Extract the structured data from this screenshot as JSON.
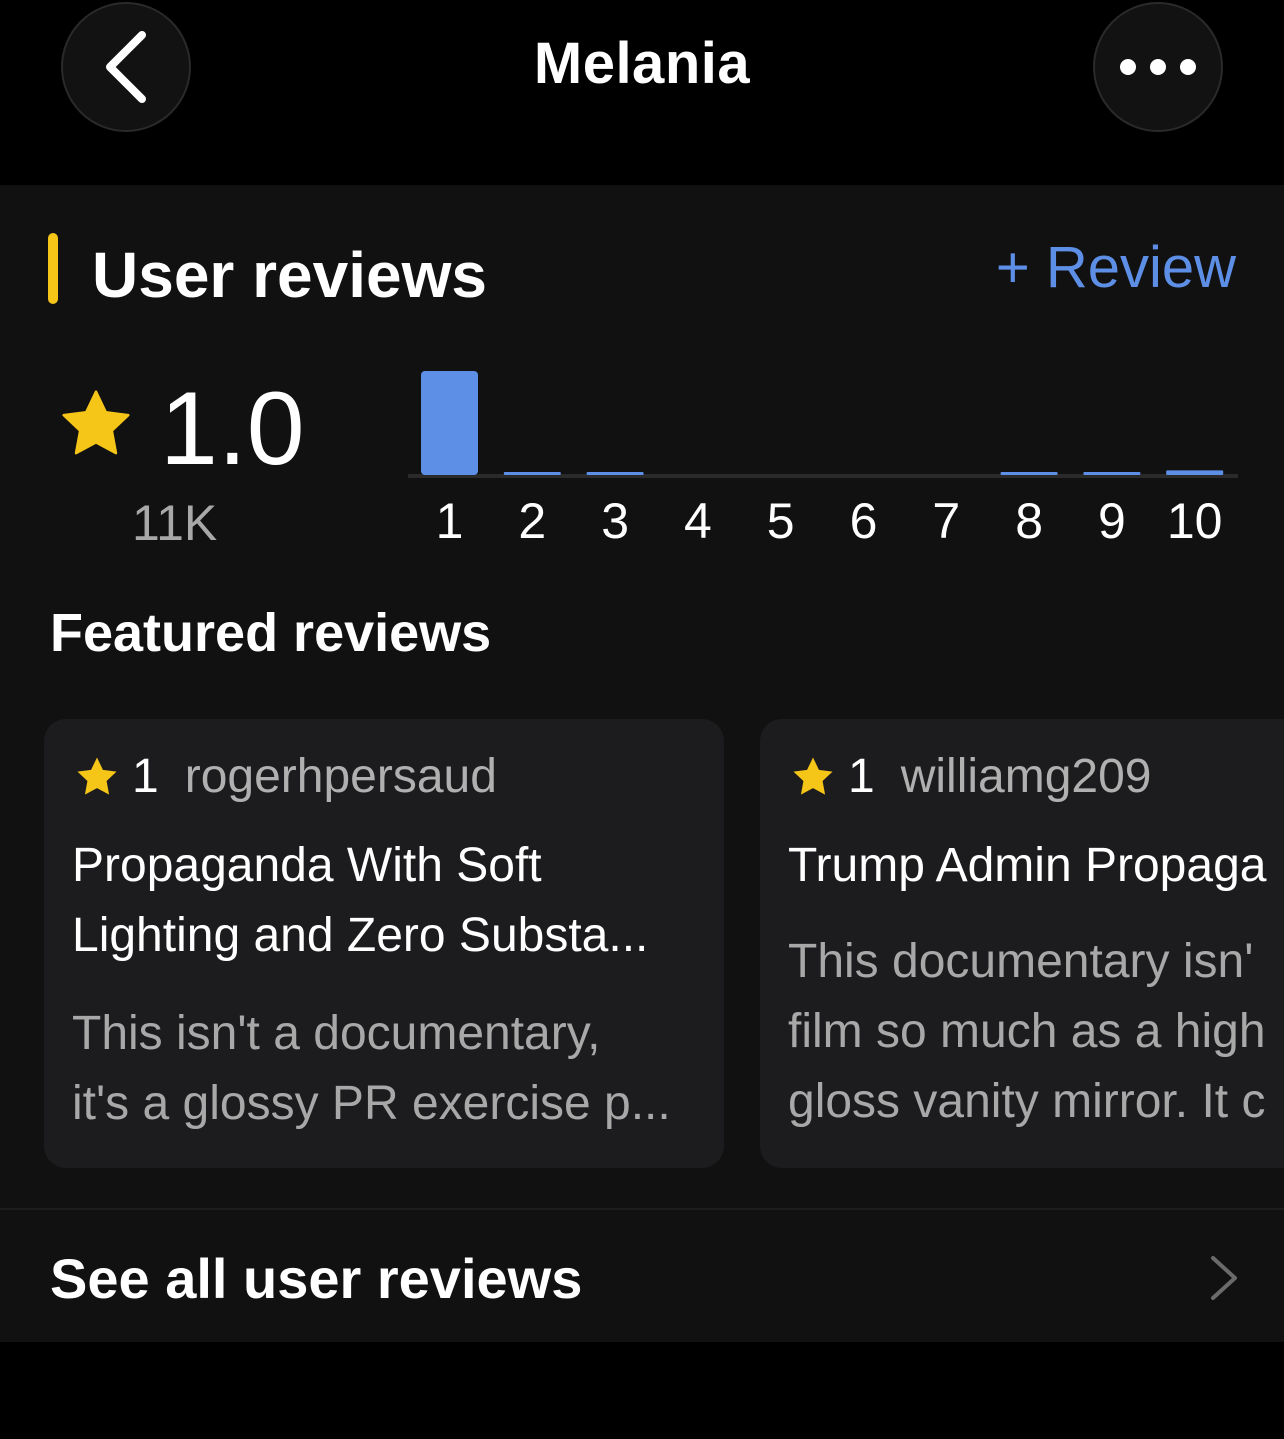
{
  "header": {
    "title": "Melania",
    "back_icon": "chevron-left-icon",
    "more_icon": "more-horizontal-icon"
  },
  "user_reviews": {
    "section_title": "User reviews",
    "add_review_label": "+ Review",
    "rating_value": "1.0",
    "rating_count": "11K",
    "star_color": "#f5c518",
    "accent_color": "#5e8fe6"
  },
  "chart_data": {
    "type": "bar",
    "categories": [
      "1",
      "2",
      "3",
      "4",
      "5",
      "6",
      "7",
      "8",
      "9",
      "10"
    ],
    "values": [
      100,
      2,
      0.8,
      0,
      0,
      0,
      0,
      0.8,
      1,
      4.5
    ],
    "ylim": [
      0,
      100
    ],
    "bar_color": "#5e8fe6"
  },
  "featured": {
    "title": "Featured reviews",
    "reviews": [
      {
        "rating": "1",
        "username": "rogerhpersaud",
        "title": "Propaganda With Soft\nLighting and Zero Substa...",
        "body": "This isn't a documentary,\nit's a glossy PR exercise p..."
      },
      {
        "rating": "1",
        "username": "williamg209",
        "title": "Trump Admin Propaga",
        "body": "This documentary isn'\nfilm so much as a high\ngloss vanity mirror. It c"
      }
    ]
  },
  "footer": {
    "see_all_label": "See all user reviews"
  }
}
